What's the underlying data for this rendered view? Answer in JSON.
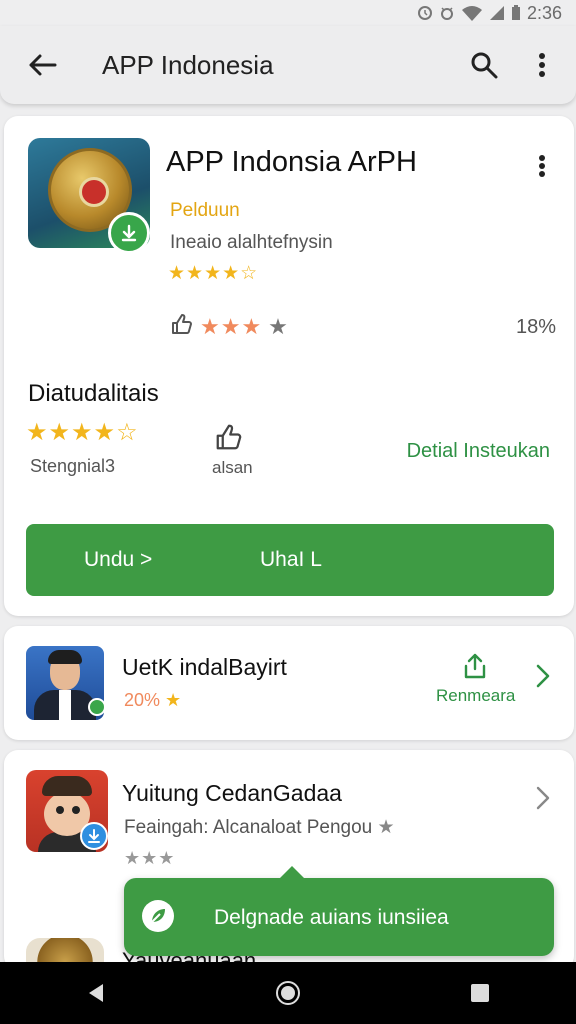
{
  "status_bar": {
    "time": "2:36"
  },
  "app_bar": {
    "title": "APP Indonesia"
  },
  "app": {
    "title": "APP Indonsia ArPH",
    "publisher": "Pelduun",
    "subtitle": "Ineaio alalhtefnysin",
    "stars": "★★★★☆",
    "secondary_stars": "★★★",
    "secondary_star_grey": "★",
    "percent": "18%"
  },
  "stats": {
    "section_title": "Diatudalitais",
    "stars": "★★★★☆",
    "stars_label": "Stengnial3",
    "thumb_label": "alsan",
    "detail_link": "Detial Insteukan"
  },
  "install_button": {
    "label_left": "Undu >",
    "label_right": "UhaI L"
  },
  "list": [
    {
      "title": "UetK indalBayirt",
      "meta": "20%",
      "meta_star": "★",
      "action_label": "Renmeara"
    },
    {
      "title": "Yuitung CedanGadaa",
      "sub": "Feaingah: Alcanaloat Pengou",
      "sub_star": "★",
      "rating": "★★★"
    }
  ],
  "third_item_title": "Yauveanuaan",
  "snackbar": {
    "message": "Delgnade auians iunsiiea"
  },
  "colors": {
    "accent_green": "#3e9b44",
    "star_gold": "#f2b51c",
    "publisher_orange": "#e3a512",
    "link_green": "#2e9144"
  }
}
